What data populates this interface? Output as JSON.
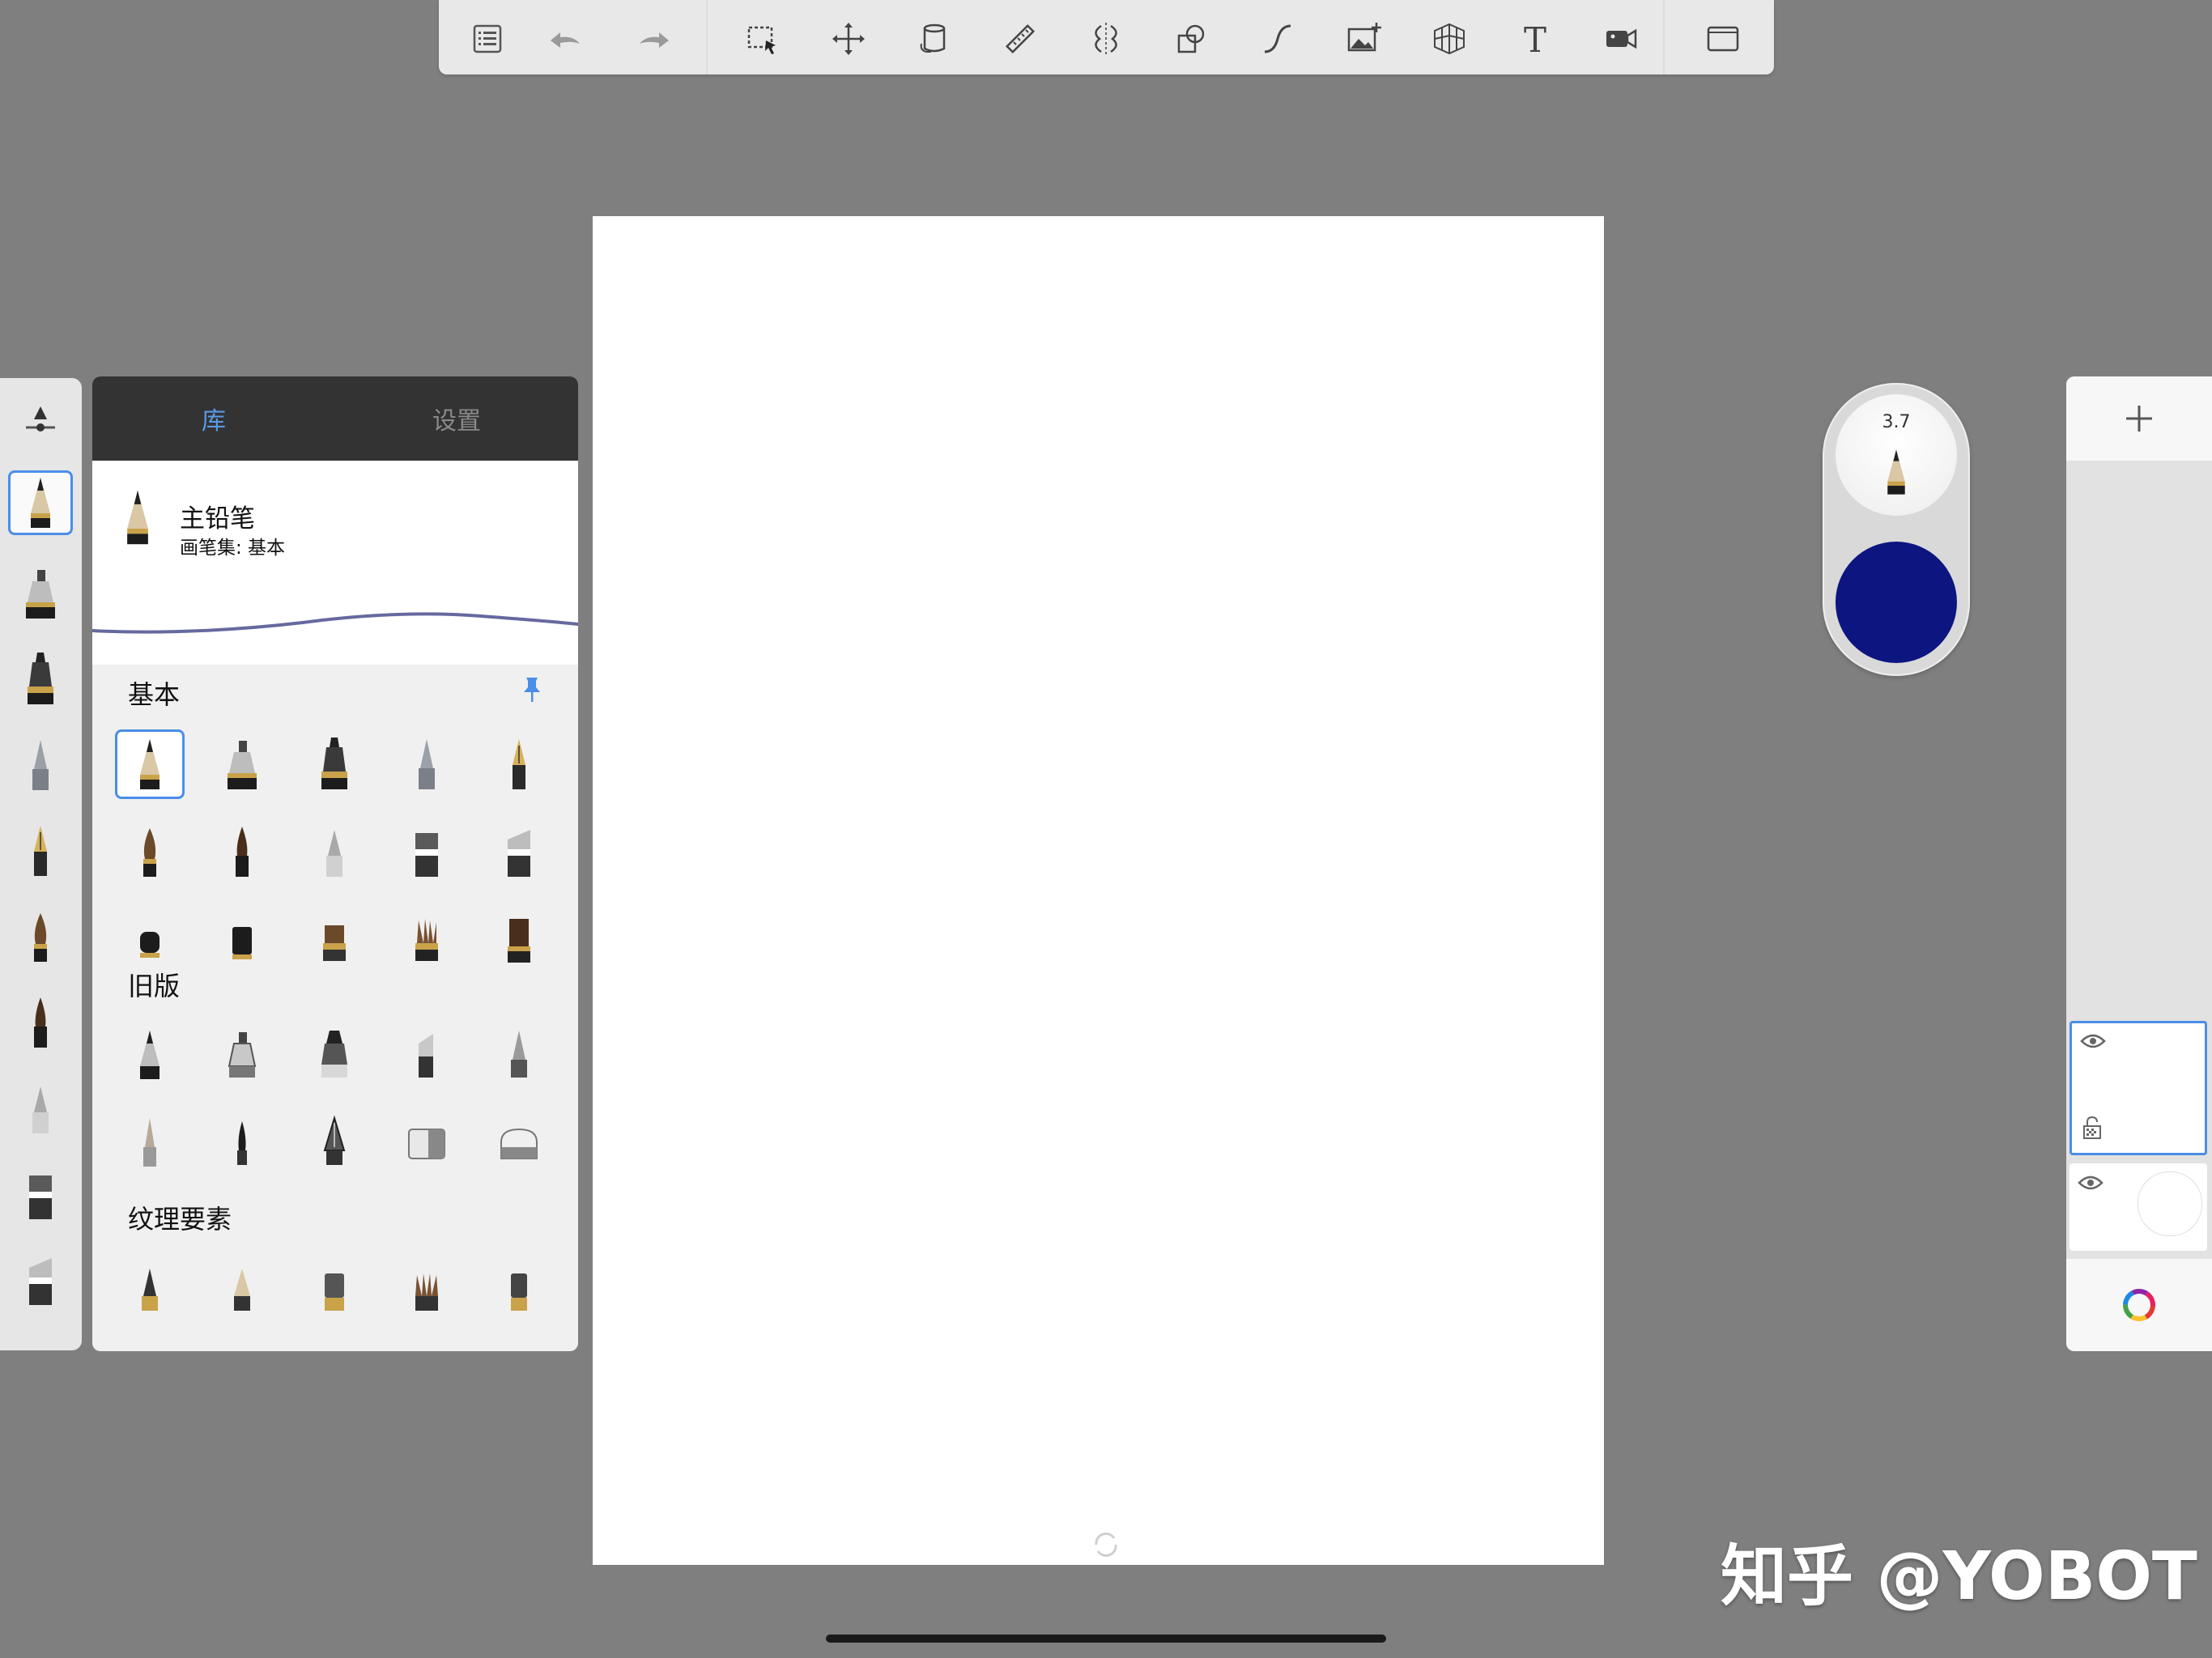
{
  "toolbar": {
    "items": [
      "list-icon",
      "undo-icon",
      "redo-icon",
      "selection-icon",
      "move-icon",
      "bucket-icon",
      "ruler-icon",
      "symmetry-icon",
      "shapes-icon",
      "curve-icon",
      "image-icon",
      "perspective-icon",
      "text-icon",
      "record-icon",
      "fullscreen-icon"
    ]
  },
  "brush_panel": {
    "tabs": {
      "library": "库",
      "settings": "设置"
    },
    "current_brush": {
      "name": "主铅笔",
      "set": "画笔集: 基本"
    },
    "sections": [
      {
        "title": "基本",
        "pinned": true
      },
      {
        "title": "旧版"
      },
      {
        "title": "纹理要素"
      }
    ]
  },
  "puck": {
    "size_value": "3.7",
    "color": "#0d1580"
  },
  "accent_color": "#4a8ee8",
  "watermark": "知乎 @YOBOT"
}
